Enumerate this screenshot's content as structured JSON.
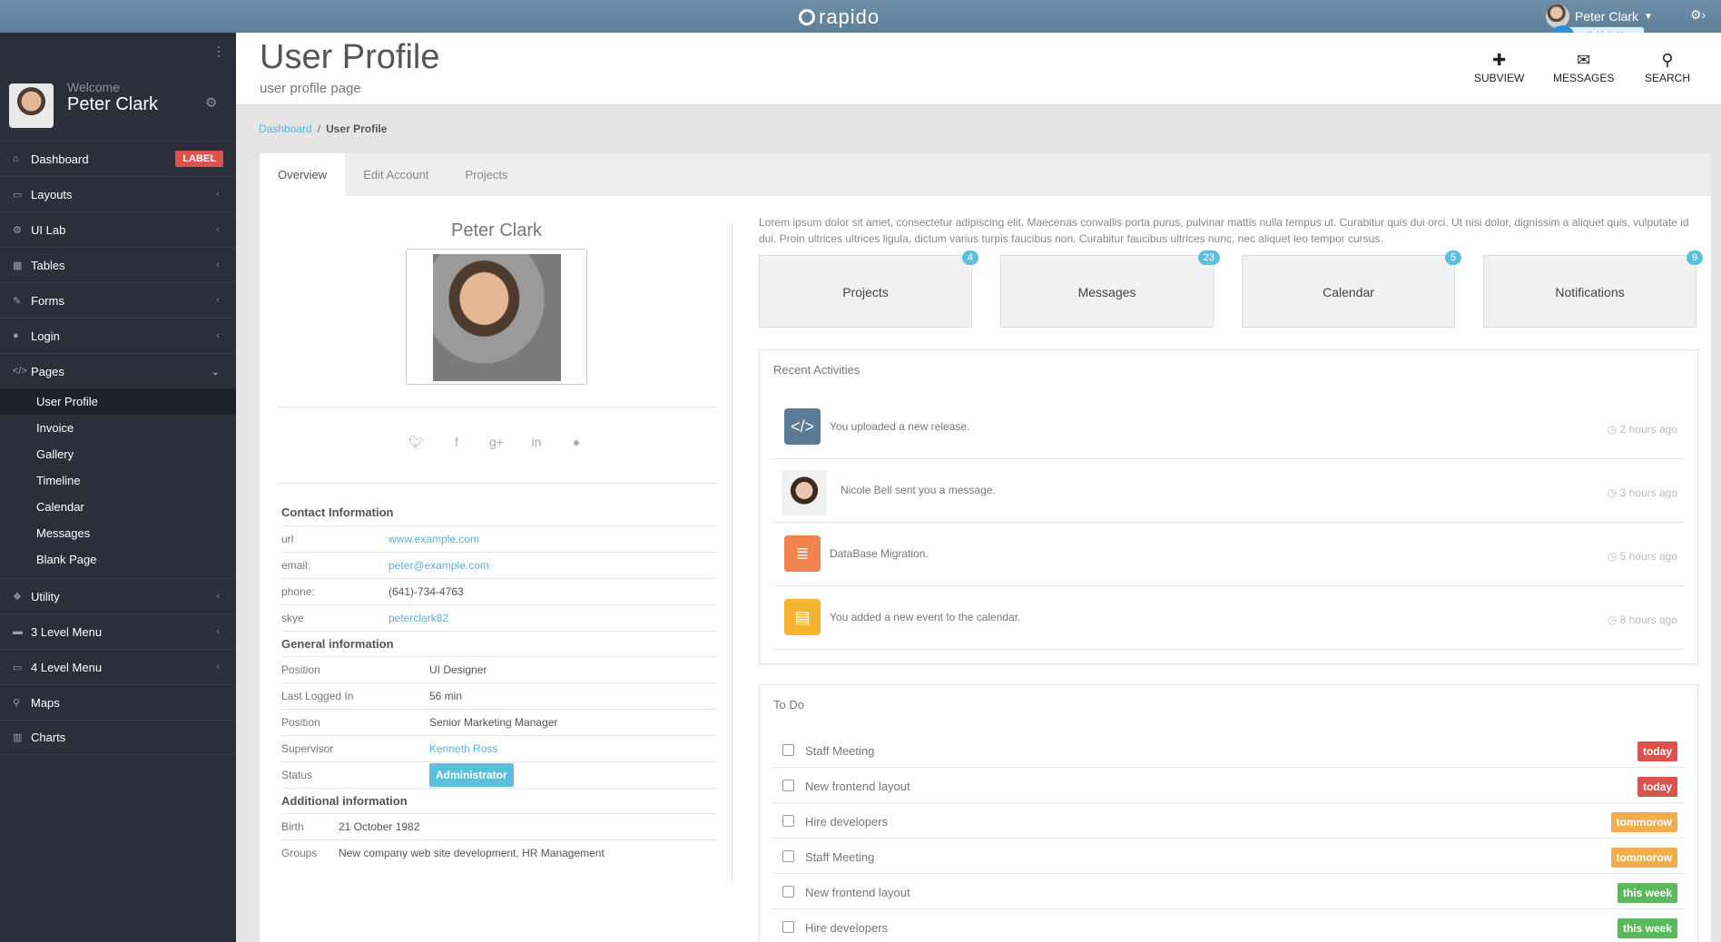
{
  "topbar": {
    "logo": "rapido",
    "user_name": "Peter Clark",
    "upload_label": "拖拽上传"
  },
  "sidebar": {
    "welcome": "Welcome",
    "user_name": "Peter Clark",
    "items": [
      {
        "label": "Dashboard",
        "icon": "home-icon",
        "badge": "LABEL"
      },
      {
        "label": "Layouts",
        "icon": "laptop-icon"
      },
      {
        "label": "UI Lab",
        "icon": "cogs-icon"
      },
      {
        "label": "Tables",
        "icon": "th-icon"
      },
      {
        "label": "Forms",
        "icon": "edit-icon"
      },
      {
        "label": "Login",
        "icon": "user-icon"
      },
      {
        "label": "Pages",
        "icon": "code-icon"
      },
      {
        "label": "Utility",
        "icon": "cubes-icon"
      },
      {
        "label": "3 Level Menu",
        "icon": "folder-icon"
      },
      {
        "label": "4 Level Menu",
        "icon": "folder-open-icon"
      },
      {
        "label": "Maps",
        "icon": "map-marker-icon"
      },
      {
        "label": "Charts",
        "icon": "chart-icon"
      }
    ],
    "pages_sub": [
      "User Profile",
      "Invoice",
      "Gallery",
      "Timeline",
      "Calendar",
      "Messages",
      "Blank Page"
    ]
  },
  "header": {
    "title": "User Profile",
    "subtitle": "user profile page",
    "buttons": [
      "SUBVIEW",
      "MESSAGES",
      "SEARCH"
    ]
  },
  "breadcrumb": {
    "home": "Dashboard",
    "separator": "/",
    "current": "User Profile"
  },
  "tabs": [
    "Overview",
    "Edit Account",
    "Projects"
  ],
  "profile": {
    "name": "Peter Clark",
    "contact_heading": "Contact Information",
    "contact": [
      {
        "k": "url",
        "v": "www.example.com"
      },
      {
        "k": "email:",
        "v": "peter@example.com"
      },
      {
        "k": "phone:",
        "v": "(641)-734-4763"
      },
      {
        "k": "skye",
        "v": "peterclark82"
      }
    ],
    "general_heading": "General information",
    "general": [
      {
        "k": "Position",
        "v": "UI Designer"
      },
      {
        "k": "Last Logged In",
        "v": "56 min"
      },
      {
        "k": "Position",
        "v": "Senior Marketing Manager"
      },
      {
        "k": "Supervisor",
        "v": "Kenneth Ross"
      },
      {
        "k": "Status",
        "v": "Administrator"
      }
    ],
    "additional_heading": "Additional information",
    "additional": [
      {
        "k": "Birth",
        "v": "21 October 1982"
      },
      {
        "k": "Groups",
        "v": "New company web site development, HR Management"
      }
    ]
  },
  "intro_text": "Lorem ipsum dolor sit amet, consectetur adipiscing elit. Maecenas convallis porta purus, pulvinar mattis nulla tempus ut. Curabitur quis dui orci. Ut nisi dolor, dignissim a aliquet quis, vulputate id dui. Proin ultrices ultrices ligula, dictum varius turpis faucibus non. Curabitur faucibus ultrices nunc, nec aliquet leo tempor cursus.",
  "stats": [
    {
      "label": "Projects",
      "count": "4"
    },
    {
      "label": "Messages",
      "count": "23"
    },
    {
      "label": "Calendar",
      "count": "5"
    },
    {
      "label": "Notifications",
      "count": "9"
    }
  ],
  "activities": {
    "title": "Recent Activities",
    "items": [
      {
        "text": "You uploaded a new release.",
        "time": "2 hours ago",
        "color": "#5b7a96"
      },
      {
        "text": "Nicole Bell sent you a message.",
        "time": "3 hours ago",
        "color": "#cccccc"
      },
      {
        "text": "DataBase Migration.",
        "time": "5 hours ago",
        "color": "#f0834e"
      },
      {
        "text": "You added a new event to the calendar.",
        "time": "8 hours ago",
        "color": "#f7b42f"
      }
    ]
  },
  "todo": {
    "title": "To Do",
    "items": [
      {
        "text": "Staff Meeting",
        "tag": "today",
        "color": "#d9534f"
      },
      {
        "text": "New frontend layout",
        "tag": "today",
        "color": "#d9534f"
      },
      {
        "text": "Hire developers",
        "tag": "tommorow",
        "color": "#f0ad4e"
      },
      {
        "text": "Staff Meeting",
        "tag": "tommorow",
        "color": "#f0ad4e"
      },
      {
        "text": "New frontend layout",
        "tag": "this week",
        "color": "#5cb85c"
      },
      {
        "text": "Hire developers",
        "tag": "this week",
        "color": "#5cb85c"
      }
    ]
  }
}
